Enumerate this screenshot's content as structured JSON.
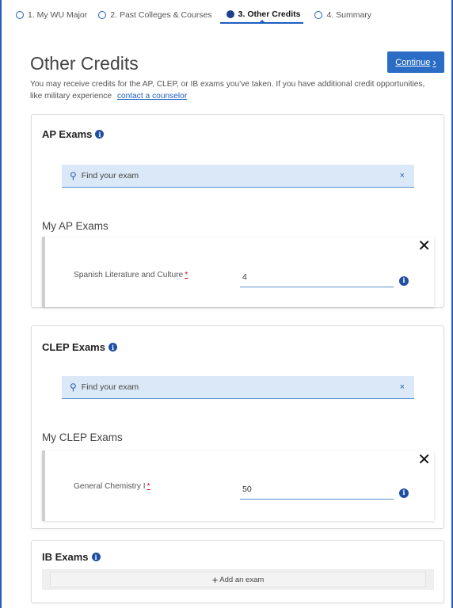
{
  "stepper": {
    "steps": [
      {
        "label": "1. My WU Major",
        "active": false
      },
      {
        "label": "2. Past Colleges & Courses",
        "active": false
      },
      {
        "label": "3. Other Credits",
        "active": true
      },
      {
        "label": "4. Summary",
        "active": false
      }
    ]
  },
  "page": {
    "title": "Other Credits",
    "continue_label": "Continue",
    "intro_text": "You may receive credits for the AP, CLEP, or IB exams you've taken. If you have additional credit opportunities, like military experience",
    "counselor_link": "contact a counselor"
  },
  "ap": {
    "title": "AP Exams",
    "search_placeholder": "Find your exam",
    "clear_symbol": "×",
    "my_exams_title": "My AP Exams",
    "exams": [
      {
        "name": "Spanish Literature and Culture",
        "required_mark": "*",
        "score": "4"
      }
    ]
  },
  "clep": {
    "title": "CLEP Exams",
    "search_placeholder": "Find your exam",
    "clear_symbol": "×",
    "my_exams_title": "My CLEP Exams",
    "exams": [
      {
        "name": "General Chemistry I",
        "required_mark": "*",
        "score": "50"
      }
    ]
  },
  "ib": {
    "title": "IB Exams",
    "add_label": "Add an exam"
  },
  "icons": {
    "info": "info-icon",
    "search": "search-icon",
    "close": "close-icon",
    "chevron": "chevron-right-icon",
    "plus": "plus-icon"
  },
  "colors": {
    "accent": "#1f5fbf",
    "button": "#2b6cc4",
    "search_bg": "#dbe8f7",
    "required": "#d0021b"
  }
}
